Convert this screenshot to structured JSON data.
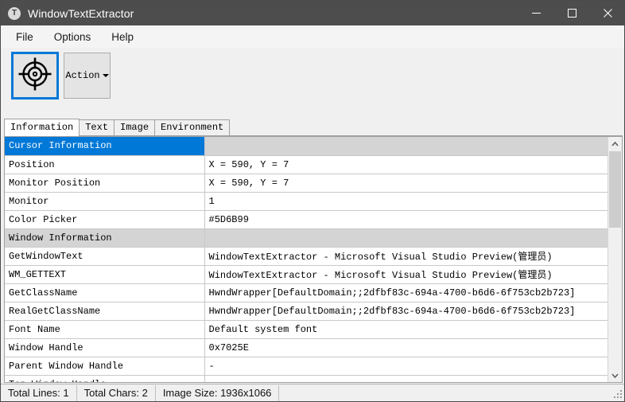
{
  "window": {
    "title": "WindowTextExtractor",
    "icon": "app-circle-t-icon",
    "minimize_label": "Minimize",
    "maximize_label": "Maximize",
    "close_label": "Close"
  },
  "menu": {
    "items": [
      {
        "label": "File"
      },
      {
        "label": "Options"
      },
      {
        "label": "Help"
      }
    ]
  },
  "toolbar": {
    "capture_icon": "crosshair-target-icon",
    "capture_label": "",
    "action_label": "Action"
  },
  "tabs": [
    {
      "label": "Information",
      "active": true
    },
    {
      "label": "Text",
      "active": false
    },
    {
      "label": "Image",
      "active": false
    },
    {
      "label": "Environment",
      "active": false
    }
  ],
  "grid": {
    "rows": [
      {
        "key": "Cursor Information",
        "value": "",
        "section": true,
        "selected": true
      },
      {
        "key": "Position",
        "value": "X = 590, Y = 7",
        "section": false,
        "selected": false
      },
      {
        "key": "Monitor Position",
        "value": "X = 590, Y = 7",
        "section": false,
        "selected": false
      },
      {
        "key": "Monitor",
        "value": "1",
        "section": false,
        "selected": false
      },
      {
        "key": "Color Picker",
        "value": "#5D6B99",
        "section": false,
        "selected": false
      },
      {
        "key": "Window Information",
        "value": "",
        "section": true,
        "selected": false
      },
      {
        "key": "GetWindowText",
        "value": "WindowTextExtractor - Microsoft Visual Studio Preview(管理员)",
        "section": false,
        "selected": false
      },
      {
        "key": "WM_GETTEXT",
        "value": "WindowTextExtractor - Microsoft Visual Studio Preview(管理员)",
        "section": false,
        "selected": false
      },
      {
        "key": "GetClassName",
        "value": "HwndWrapper[DefaultDomain;;2dfbf83c-694a-4700-b6d6-6f753cb2b723]",
        "section": false,
        "selected": false
      },
      {
        "key": "RealGetClassName",
        "value": "HwndWrapper[DefaultDomain;;2dfbf83c-694a-4700-b6d6-6f753cb2b723]",
        "section": false,
        "selected": false
      },
      {
        "key": "Font Name",
        "value": "Default system font",
        "section": false,
        "selected": false
      },
      {
        "key": "Window Handle",
        "value": "0x7025E",
        "section": false,
        "selected": false
      },
      {
        "key": "Parent Window Handle",
        "value": "-",
        "section": false,
        "selected": false
      },
      {
        "key": "Top Window Handle",
        "value": "-",
        "section": false,
        "selected": false
      }
    ]
  },
  "scrollbar": {
    "up_icon": "chevron-up-icon",
    "down_icon": "chevron-down-icon"
  },
  "statusbar": {
    "total_lines": "Total Lines: 1",
    "total_chars": "Total Chars: 2",
    "image_size": "Image Size: 1936x1066",
    "grip_icon": "resize-grip-icon"
  },
  "colors": {
    "titlebar": "#4d4d4d",
    "accent": "#0078d7",
    "section_row": "#d4d4d4",
    "picked_color": "#5D6B99"
  }
}
